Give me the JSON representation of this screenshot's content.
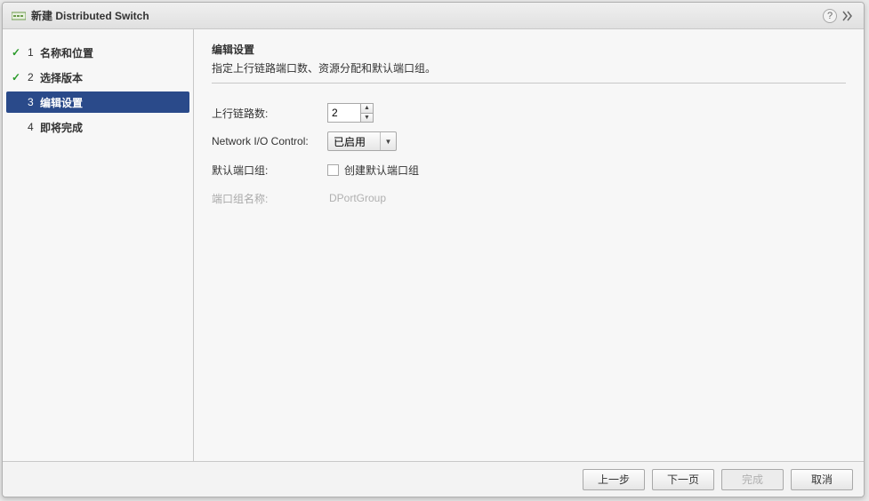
{
  "title": "新建 Distributed Switch",
  "steps": [
    {
      "num": "1",
      "label": "名称和位置",
      "state": "done"
    },
    {
      "num": "2",
      "label": "选择版本",
      "state": "done"
    },
    {
      "num": "3",
      "label": "编辑设置",
      "state": "active"
    },
    {
      "num": "4",
      "label": "即将完成",
      "state": "upcoming"
    }
  ],
  "section": {
    "title": "编辑设置",
    "subtitle": "指定上行链路端口数、资源分配和默认端口组。"
  },
  "form": {
    "uplink_label": "上行链路数:",
    "uplink_value": "2",
    "nioc_label": "Network I/O Control:",
    "nioc_value": "已启用",
    "default_pg_label": "默认端口组:",
    "default_pg_checkbox_label": "创建默认端口组",
    "pg_name_label": "端口组名称:",
    "pg_name_value": "DPortGroup"
  },
  "footer": {
    "back": "上一步",
    "next": "下一页",
    "finish": "完成",
    "cancel": "取消"
  }
}
